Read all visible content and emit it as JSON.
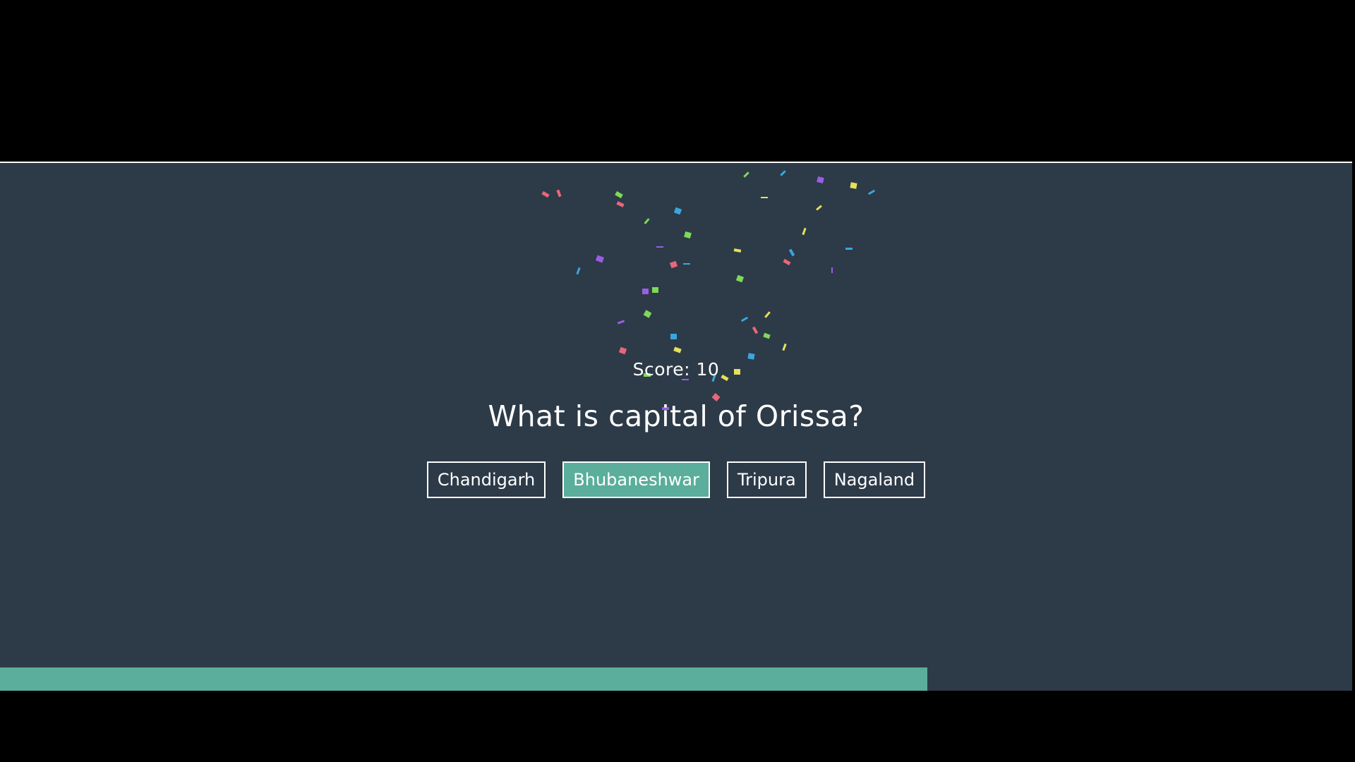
{
  "score": {
    "text": "Score: 10"
  },
  "question": {
    "text": "What is capital of Orissa?"
  },
  "answers": [
    {
      "label": "Chandigarh",
      "selected": false
    },
    {
      "label": "Bhubaneshwar",
      "selected": true
    },
    {
      "label": "Tripura",
      "selected": false
    },
    {
      "label": "Nagaland",
      "selected": false
    }
  ],
  "progress": {
    "fraction": 0.686
  },
  "colors": {
    "background": "#2d3a48",
    "accent": "#5aae9b",
    "text": "#ffffff",
    "confetti": [
      "#e9677a",
      "#7ed957",
      "#3aa6e0",
      "#9b5de5",
      "#e6e05a"
    ]
  }
}
